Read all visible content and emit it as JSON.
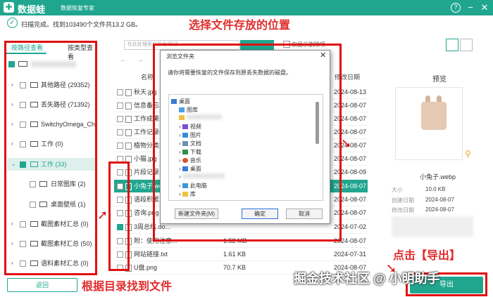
{
  "app": {
    "name": "数据蛙",
    "subtitle": "数据恢复专家",
    "help": "?",
    "min": "−",
    "close": "✕"
  },
  "status": {
    "text": "扫描完成。找到103490个文件共13.2 GB。"
  },
  "annotations": {
    "top": "选择文件存放的位置",
    "left": "根据目录找到文件",
    "right": "点击【导出】"
  },
  "tabs": {
    "path": "按路径查看",
    "type": "按类型查看"
  },
  "tree": [
    {
      "label": "其他路径 (29352)"
    },
    {
      "label": "丢失路径 (71392)"
    },
    {
      "label": "SwitchyOmega_Chromium"
    },
    {
      "label": "工作 (0)"
    },
    {
      "label": "工作 (33)"
    },
    {
      "label": "日常图库 (2)"
    },
    {
      "label": "桌面壁纸 (1)"
    },
    {
      "label": "截图素材汇总 (0)"
    },
    {
      "label": "截图素材汇总 (50)"
    },
    {
      "label": "语料素材汇总 (0)"
    }
  ],
  "back": "返回",
  "search": {
    "placeholder": "在此处搜索文件名/路径"
  },
  "filter": {
    "label": "仅显示删除项"
  },
  "columns": {
    "name": "名称",
    "modified": "修改日期"
  },
  "files": [
    {
      "name": "秋天.jpg",
      "size": "",
      "date": "2024-08-13"
    },
    {
      "name": "信息备忘.txt",
      "size": "",
      "date": "2024-08-07"
    },
    {
      "name": "工作成果分...",
      "size": "",
      "date": "2024-08-07"
    },
    {
      "name": "工作记录表...",
      "size": "",
      "date": "2024-08-07"
    },
    {
      "name": "植物分类.d...",
      "size": "",
      "date": "2024-08-07"
    },
    {
      "name": "小猫.jpg",
      "size": "",
      "date": "2024-08-07"
    },
    {
      "name": "片段记录.t...",
      "size": "",
      "date": "2024-08-09"
    },
    {
      "name": "小兔子.web...",
      "size": "",
      "date": "2024-08-07"
    },
    {
      "name": "语段积累.d...",
      "size": "",
      "date": "2024-08-07"
    },
    {
      "name": "咨询.png",
      "size": "",
      "date": "2024-08-07"
    },
    {
      "name": "3周总结.do...",
      "size": "",
      "date": "2024-07-02"
    },
    {
      "name": "附：使用注意...",
      "size": "1.52 MB",
      "date": "2024-08-07"
    },
    {
      "name": "网站链接.txt",
      "size": "1.61 KB",
      "date": "2024-07-31"
    },
    {
      "name": "U盘.png",
      "size": "70.7 KB",
      "date": "2024-08-07"
    }
  ],
  "preview": {
    "title": "预览",
    "filename": "小兔子.webp",
    "size_label": "大小",
    "size": "10.0 KB",
    "created_label": "创建日期",
    "created": "2024-08-07",
    "modified_label": "修改日期",
    "modified": "2024-08-07"
  },
  "export": "导出",
  "dialog": {
    "title": "浏览文件夹",
    "close": "✕",
    "message": "请你将需要恢复的文件保存到原丢失数据的磁盘。",
    "new_folder": "新建文件夹(M)",
    "ok": "确定",
    "cancel": "取消",
    "items": [
      {
        "label": "桌面",
        "indent": 0,
        "arrow": ""
      },
      {
        "label": "图库",
        "indent": 1,
        "arrow": ""
      },
      {
        "label": "",
        "indent": 1,
        "arrow": ""
      },
      {
        "label": "视频",
        "indent": 1,
        "arrow": "›"
      },
      {
        "label": "图片",
        "indent": 1,
        "arrow": "›"
      },
      {
        "label": "文档",
        "indent": 1,
        "arrow": "›"
      },
      {
        "label": "下载",
        "indent": 1,
        "arrow": "›"
      },
      {
        "label": "音乐",
        "indent": 1,
        "arrow": "›"
      },
      {
        "label": "桌面",
        "indent": 1,
        "arrow": "›"
      },
      {
        "label": "",
        "indent": 1,
        "arrow": "›"
      },
      {
        "label": "此电脑",
        "indent": 1,
        "arrow": "›"
      },
      {
        "label": "库",
        "indent": 1,
        "arrow": "›"
      }
    ]
  },
  "watermark": "掘金技术社区 @ 小明助手",
  "colors": {
    "accent": "#20a68f",
    "annotation": "#e12c2c",
    "box": "#e01010"
  }
}
